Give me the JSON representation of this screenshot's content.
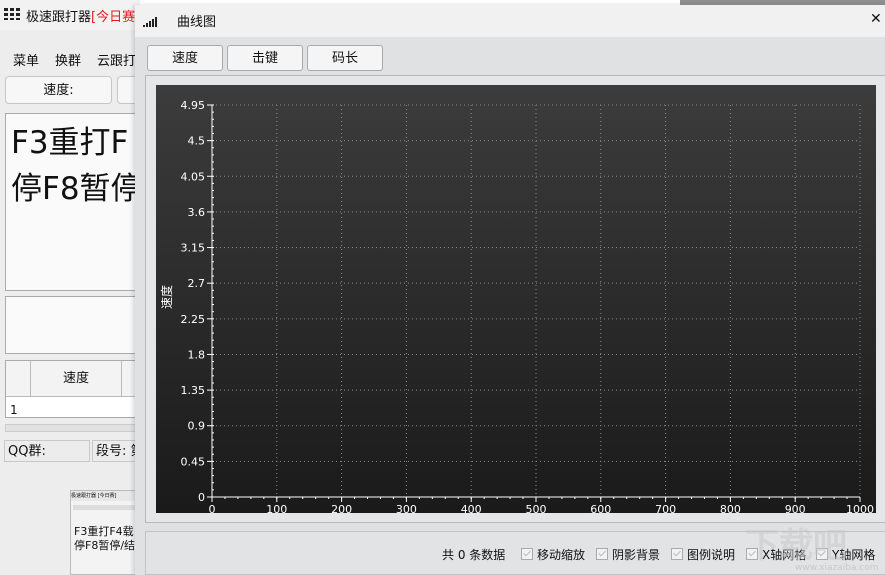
{
  "main_window": {
    "title": "极速跟打器",
    "title_highlight": "[今日赛",
    "menu": [
      "菜单",
      "换群",
      "云跟打"
    ],
    "buttons": [
      "速度:"
    ],
    "article_text": "F3重打F\n停F8暂停",
    "table": {
      "header": "速度",
      "row_number": "1"
    },
    "status_qq": "QQ群:",
    "status_segment": "段号: 第",
    "thumbnail": {
      "title": "极速跟打器 [今日赛]",
      "text": "F3重打F4载\n停F8暂停/结"
    }
  },
  "chart_window": {
    "title": "曲线图",
    "tabs": [
      "速度",
      "击键",
      "码长"
    ],
    "count_label": "共 0 条数据",
    "options": [
      "移动缩放",
      "阴影背景",
      "图例说明",
      "X轴网格",
      "Y轴网格"
    ],
    "colors": {
      "plot_top": "#3c3c3c",
      "plot_bottom": "#1a1a1a",
      "axis": "#ffffff",
      "grid": "#8a8a8a"
    }
  },
  "chart_data": {
    "type": "line",
    "ylabel": "速度",
    "xlabel": "",
    "title": "",
    "series": [],
    "xlim": [
      0,
      1000
    ],
    "ylim": [
      0,
      4.95
    ],
    "x_ticks": [
      0,
      100,
      200,
      300,
      400,
      500,
      600,
      700,
      800,
      900,
      1000
    ],
    "y_ticks": [
      "0",
      "0.45",
      "0.9",
      "1.35",
      "1.8",
      "2.25",
      "2.7",
      "3.15",
      "3.6",
      "4.05",
      "4.5",
      "4.95"
    ],
    "grid": true
  },
  "watermark": {
    "text": "下载吧",
    "url": "www.xiazaiba.com"
  }
}
